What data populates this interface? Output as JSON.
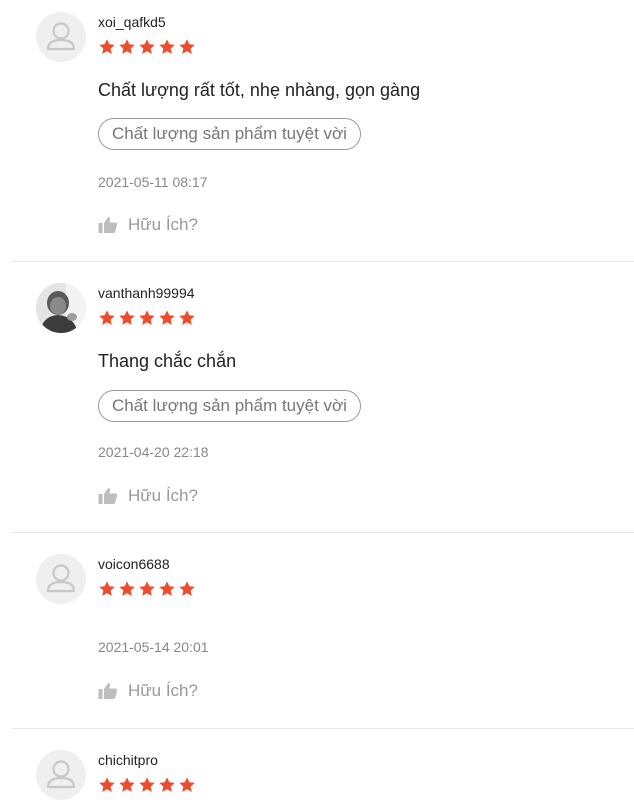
{
  "colors": {
    "star": "#ee4d2d",
    "border": "#9b9b9b",
    "muted": "#888888"
  },
  "reviews": [
    {
      "username": "xoi_qafkd5",
      "rating": 5,
      "avatar": "default-user-icon",
      "comment": "Chất lượng rất tốt, nhẹ nhàng, gọn gàng",
      "tag": "Chất lượng sản phẩm tuyệt vời",
      "date": "2021-05-11 08:17",
      "helpful_label": "Hữu Ích?"
    },
    {
      "username": "vanthanh99994",
      "rating": 5,
      "avatar": "user-photo",
      "comment": "Thang chắc chắn",
      "tag": "Chất lượng sản phẩm tuyệt vời",
      "date": "2021-04-20 22:18",
      "helpful_label": "Hữu Ích?"
    },
    {
      "username": "voicon6688",
      "rating": 5,
      "avatar": "default-user-icon",
      "date": "2021-05-14 20:01",
      "helpful_label": "Hữu Ích?"
    },
    {
      "username": "chichitpro",
      "rating": 5,
      "avatar": "default-user-icon"
    }
  ]
}
